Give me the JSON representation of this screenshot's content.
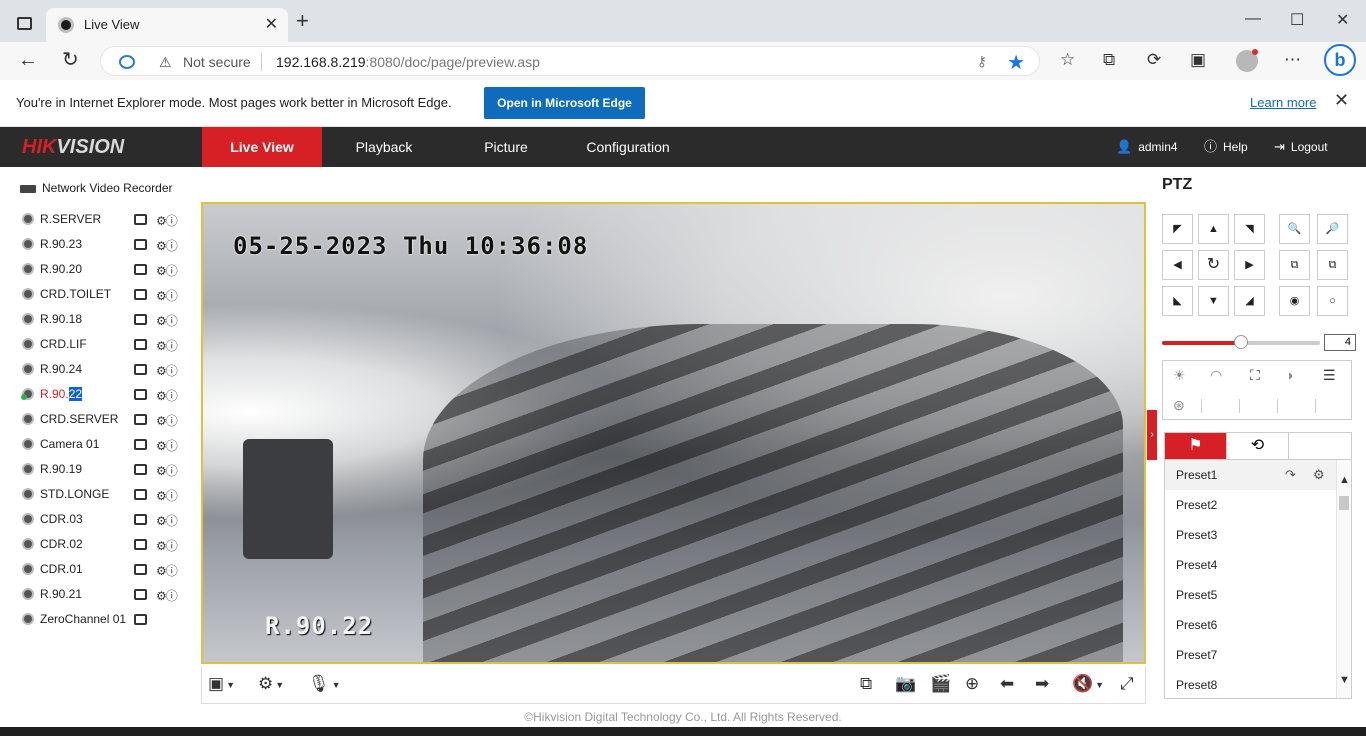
{
  "browser": {
    "tab_title": "Live View",
    "close_glyph": "✕",
    "new_tab_glyph": "+",
    "minimize_glyph": "—",
    "maximize_glyph": "☐",
    "window_close_glyph": "✕",
    "security_label": "Not secure",
    "url_host": "192.168.8.219",
    "url_rest": ":8080/doc/page/preview.asp"
  },
  "ie_bar": {
    "message": "You're in Internet Explorer mode. Most pages work better in Microsoft Edge.",
    "open_button": "Open in Microsoft Edge",
    "learn_more": "Learn more",
    "close_glyph": "✕"
  },
  "header": {
    "logo_main": "HIK",
    "logo_accent": "VISION",
    "nav": [
      {
        "label": "Live View"
      },
      {
        "label": "Playback"
      },
      {
        "label": "Picture"
      },
      {
        "label": "Configuration"
      }
    ],
    "user": "admin4",
    "help": "Help",
    "logout": "Logout"
  },
  "channels": {
    "root": "Network Video Recorder",
    "items": [
      {
        "name": "R.SERVER"
      },
      {
        "name": "R.90.23"
      },
      {
        "name": "R.90.20"
      },
      {
        "name": "CRD.TOILET"
      },
      {
        "name": "R.90.18"
      },
      {
        "name": "CRD.LIF"
      },
      {
        "name": "R.90.24"
      },
      {
        "name": "R.90.",
        "highlight": "22"
      },
      {
        "name": "CRD.SERVER"
      },
      {
        "name": "Camera 01"
      },
      {
        "name": "R.90.19"
      },
      {
        "name": "STD.LONGE"
      },
      {
        "name": "CDR.03"
      },
      {
        "name": "CDR.02"
      },
      {
        "name": "CDR.01"
      },
      {
        "name": "R.90.21"
      },
      {
        "name": "ZeroChannel 01"
      }
    ]
  },
  "video": {
    "timestamp": "05-25-2023 Thu 10:36:08",
    "channel_label": "R.90.22"
  },
  "footer": {
    "copyright": "©Hikvision Digital Technology Co., Ltd. All Rights Reserved."
  },
  "ptz": {
    "title": "PTZ",
    "speed": "4",
    "speed_level": 0.5,
    "presets": [
      "Preset1",
      "Preset2",
      "Preset3",
      "Preset4",
      "Preset5",
      "Preset6",
      "Preset7",
      "Preset8"
    ]
  },
  "colors": {
    "brand_red": "#d71f26",
    "header_bg": "#2b2b2b",
    "edge_blue": "#0f6cbd"
  }
}
